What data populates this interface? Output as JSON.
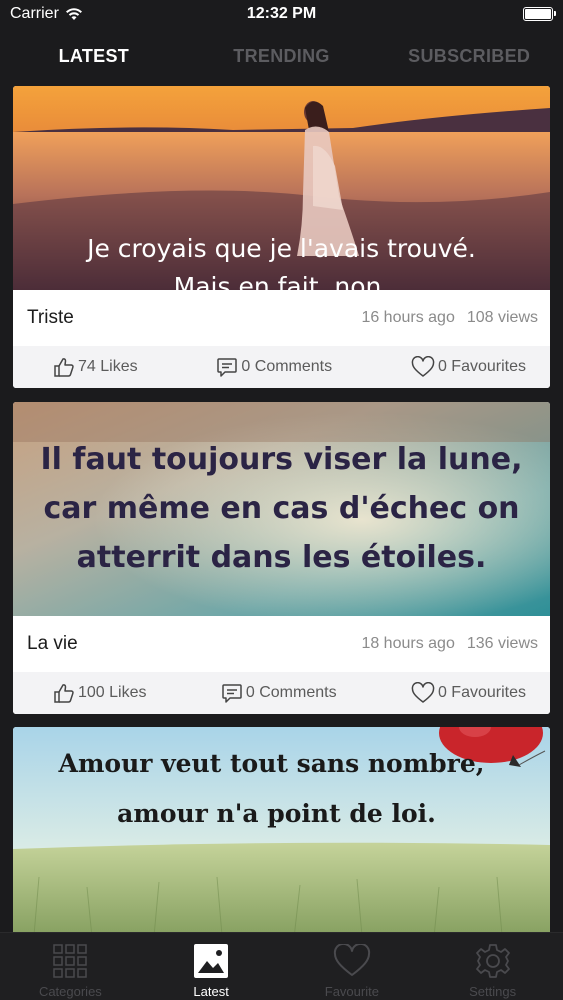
{
  "status_bar": {
    "carrier": "Carrier",
    "time": "12:32 PM"
  },
  "top_tabs": [
    {
      "label": "LATEST",
      "active": true
    },
    {
      "label": "TRENDING",
      "active": false
    },
    {
      "label": "SUBSCRIBED",
      "active": false
    }
  ],
  "posts": [
    {
      "image_text_1": "Je croyais que je l'avais trouvé.",
      "image_text_2": "Mais en fait, non.",
      "category": "Triste",
      "time_ago": "16 hours ago",
      "views": "108 views",
      "likes": "74 Likes",
      "comments": "0 Comments",
      "favourites": "0 Favourites"
    },
    {
      "image_text_1": "Il faut toujours viser la lune,",
      "image_text_2": "car même en cas d'échec on",
      "image_text_3": "atterrit dans les étoiles.",
      "category": "La vie",
      "time_ago": "18 hours ago",
      "views": "136 views",
      "likes": "100 Likes",
      "comments": "0 Comments",
      "favourites": "0 Favourites"
    },
    {
      "image_text_1": "Amour veut tout sans nombre,",
      "image_text_2": "amour n'a point de loi."
    }
  ],
  "tab_bar": {
    "categories": "Categories",
    "latest": "Latest",
    "favourite": "Favourite",
    "settings": "Settings",
    "active": "latest"
  },
  "colors": {
    "background": "#1b1b1d",
    "active_tab": "#ffffff",
    "inactive_tab": "#5c5c60"
  }
}
